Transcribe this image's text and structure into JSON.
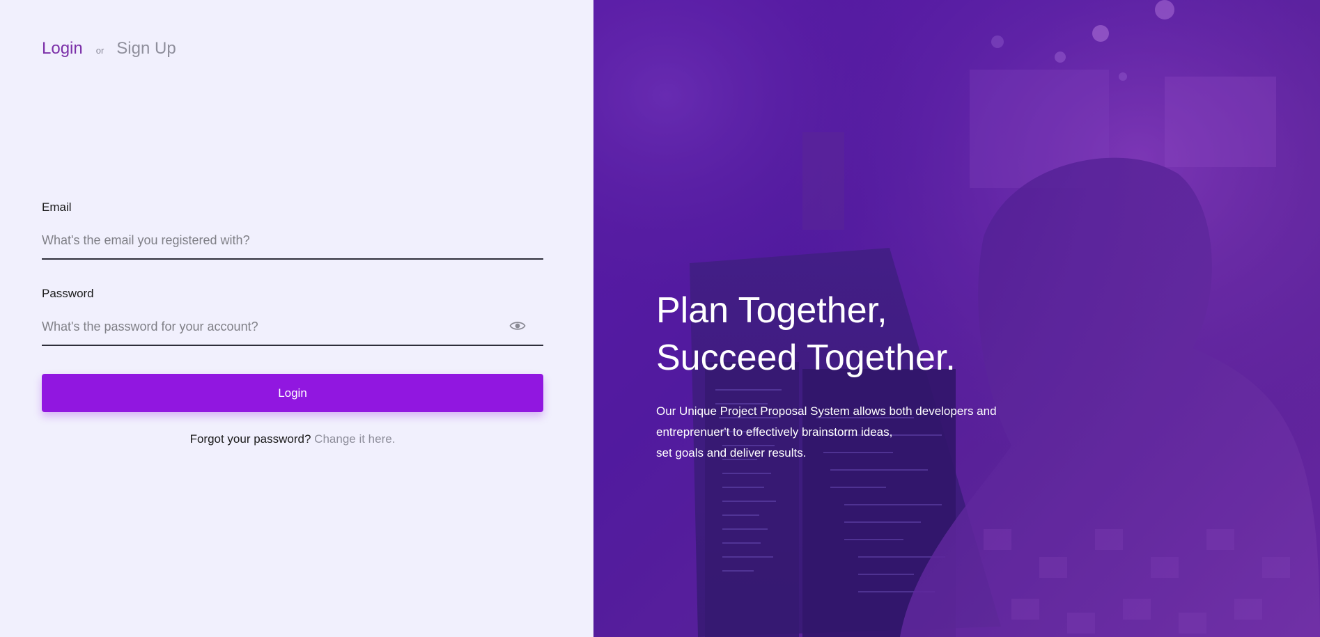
{
  "auth_tabs": {
    "login_label": "Login",
    "or_label": "or",
    "signup_label": "Sign Up"
  },
  "form": {
    "email": {
      "label": "Email",
      "placeholder": "What's the email you registered with?",
      "value": ""
    },
    "password": {
      "label": "Password",
      "placeholder": "What's the password for your account?",
      "value": "",
      "toggle_icon": "eye-icon"
    },
    "submit_label": "Login",
    "forgot_text": "Forgot your password?",
    "forgot_link": "Change it here."
  },
  "hero": {
    "title_line1": "Plan Together,",
    "title_line2": "Succeed Together.",
    "desc_line1": "Our Unique Project Proposal System allows both developers and",
    "desc_line2": "entreprenuer't to effectively brainstorm ideas,",
    "desc_line3": "set goals and deliver results."
  },
  "colors": {
    "accent": "#9117e0",
    "tab_active": "#7b2fa8",
    "left_background": "#f1f0fd",
    "hero_overlay": "#5b1aa8"
  }
}
